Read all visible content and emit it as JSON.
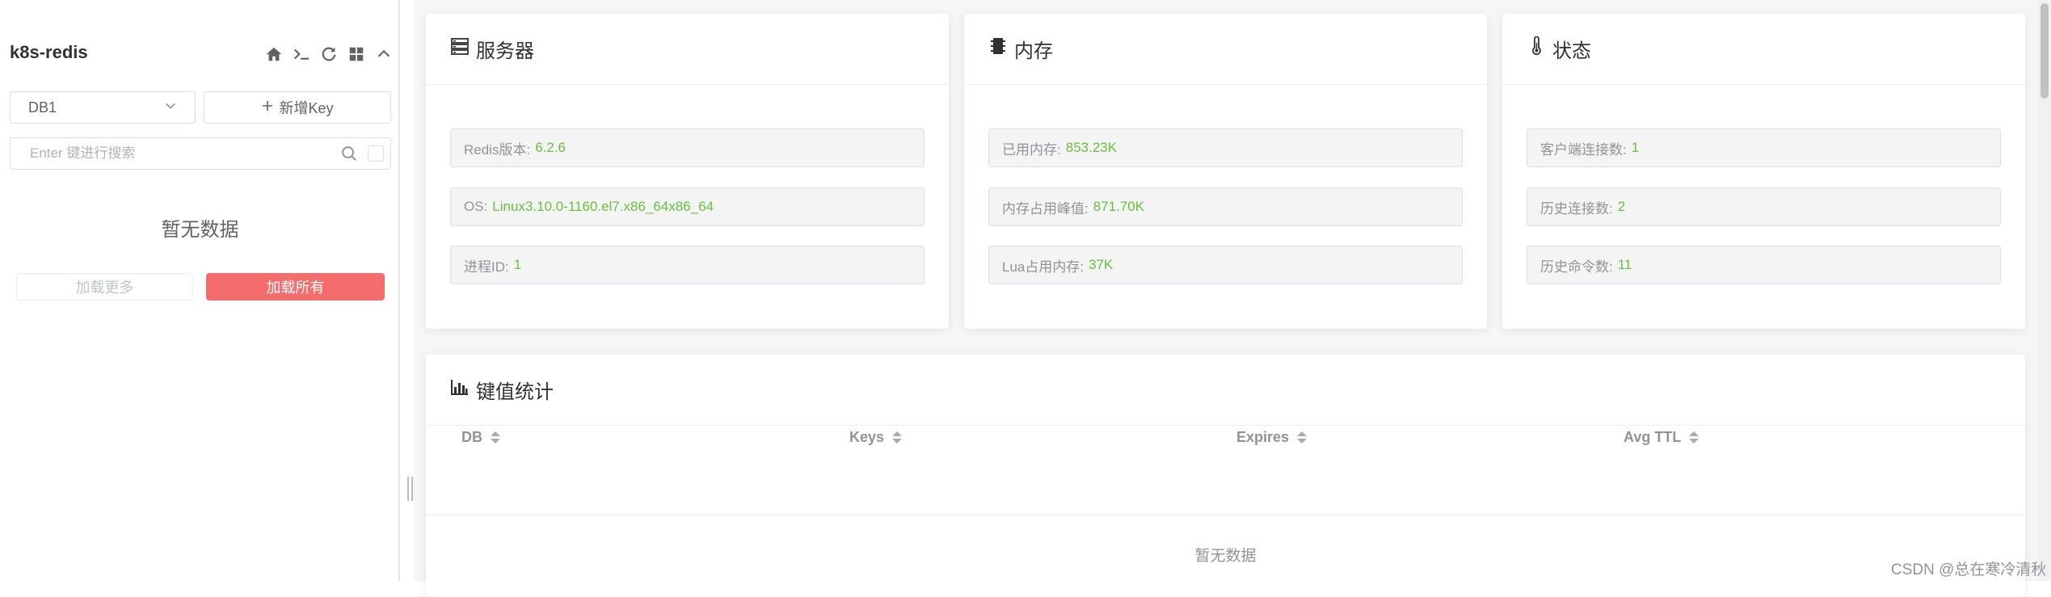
{
  "sidebar": {
    "connection_name": "k8s-redis",
    "tools": [
      "home-icon",
      "terminal-icon",
      "refresh-icon",
      "grid-icon",
      "chevron-up-icon"
    ],
    "db_select": {
      "value": "DB1"
    },
    "new_key_label": "新增Key",
    "search": {
      "placeholder": "Enter 键进行搜索",
      "value": ""
    },
    "empty_text": "暂无数据",
    "load_more_label": "加载更多",
    "load_all_label": "加载所有"
  },
  "server_card": {
    "title": "服务器",
    "rows": [
      {
        "label": "Redis版本:",
        "value": "6.2.6"
      },
      {
        "label": "OS:",
        "value": "Linux3.10.0-1160.el7.x86_64x86_64"
      },
      {
        "label": "进程ID:",
        "value": "1"
      }
    ]
  },
  "memory_card": {
    "title": "内存",
    "rows": [
      {
        "label": "已用内存:",
        "value": "853.23K"
      },
      {
        "label": "内存占用峰值:",
        "value": "871.70K"
      },
      {
        "label": "Lua占用内存:",
        "value": "37K"
      }
    ]
  },
  "status_card": {
    "title": "状态",
    "rows": [
      {
        "label": "客户端连接数:",
        "value": "1"
      },
      {
        "label": "历史连接数:",
        "value": "2"
      },
      {
        "label": "历史命令数:",
        "value": "11"
      }
    ]
  },
  "keys_card": {
    "title": "键值统计",
    "columns": [
      "DB",
      "Keys",
      "Expires",
      "Avg TTL"
    ],
    "empty_text": "暂无数据"
  },
  "watermark": "CSDN @总在寒冷清秋",
  "colors": {
    "accent_red": "#f56c6c",
    "value_green": "#67c23a"
  }
}
